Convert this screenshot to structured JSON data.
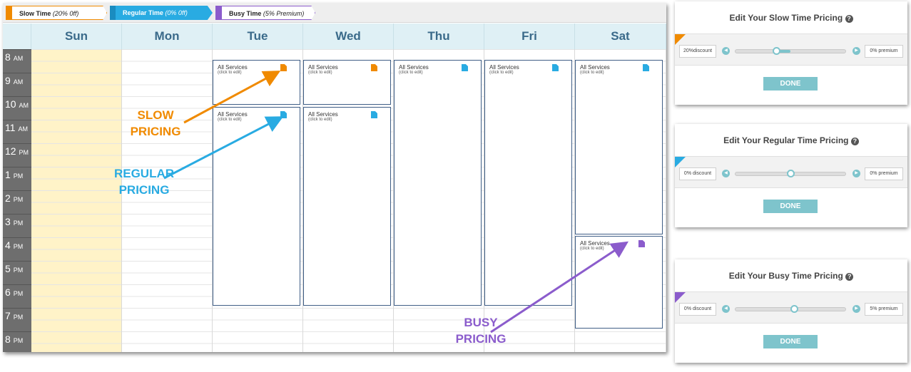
{
  "legend": {
    "slow": {
      "name": "Slow Time",
      "note": "(20% 0ff)"
    },
    "regular": {
      "name": "Regular Time",
      "note": "(0% 0ff)"
    },
    "busy": {
      "name": "Busy Time",
      "note": "(5% Premium)"
    }
  },
  "days": [
    "Sun",
    "Mon",
    "Tue",
    "Wed",
    "Thu",
    "Fri",
    "Sat"
  ],
  "times": [
    {
      "hour": "8",
      "ampm": "AM"
    },
    {
      "hour": "9",
      "ampm": "AM"
    },
    {
      "hour": "10",
      "ampm": "AM"
    },
    {
      "hour": "11",
      "ampm": "AM"
    },
    {
      "hour": "12",
      "ampm": "PM"
    },
    {
      "hour": "1",
      "ampm": "PM"
    },
    {
      "hour": "2",
      "ampm": "PM"
    },
    {
      "hour": "3",
      "ampm": "PM"
    },
    {
      "hour": "4",
      "ampm": "PM"
    },
    {
      "hour": "5",
      "ampm": "PM"
    },
    {
      "hour": "6",
      "ampm": "PM"
    },
    {
      "hour": "7",
      "ampm": "PM"
    },
    {
      "hour": "8",
      "ampm": "PM"
    }
  ],
  "block": {
    "title": "All Services",
    "sub": "(click to edit)"
  },
  "annotations": {
    "slow": [
      "SLOW",
      "PRICING"
    ],
    "regular": [
      "REGULAR",
      "PRICING"
    ],
    "busy": [
      "BUSY",
      "PRICING"
    ]
  },
  "panels": [
    {
      "title": "Edit Your Slow Time Pricing",
      "discount": "20%discount",
      "premium": "0% premium",
      "level_percent": 37,
      "button": "DONE"
    },
    {
      "title": "Edit Your Regular Time Pricing",
      "discount": "0% discount",
      "premium": "0% premium",
      "level_percent": 50,
      "button": "DONE"
    },
    {
      "title": "Edit Your Busy Time Pricing",
      "discount": "0% discount",
      "premium": "5% premium",
      "level_percent": 53,
      "button": "DONE"
    }
  ],
  "help_icon": "?",
  "colors": {
    "slow": "#f08a00",
    "regular": "#29abe2",
    "busy": "#8b5ccc"
  }
}
